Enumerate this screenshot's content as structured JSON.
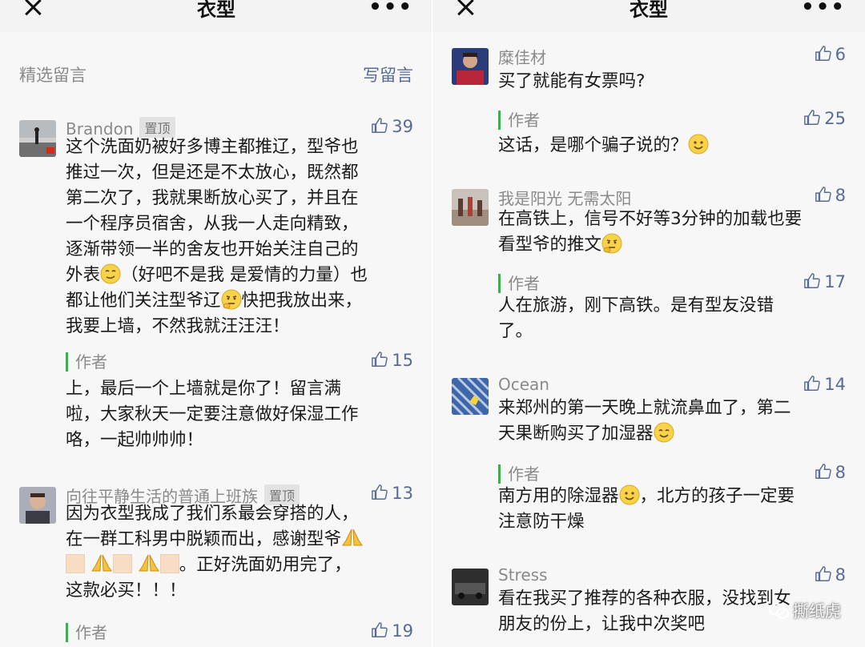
{
  "left": {
    "title": "衣型",
    "featured_label": "精选留言",
    "write_label": "写留言",
    "comments": [
      {
        "name": "Brandon",
        "pin": "置顶",
        "likes": "39",
        "lines": [
          "这个洗面奶被好多博主都推辽，型爷也",
          "推过一次，但是还是不太放心，既然都",
          "第二次了，我就果断放心买了，并且在",
          "一个程序员宿舍，从我一人走向精致，",
          "逐渐带领一半的舍友也开始关注自己的"
        ],
        "line6a": "外表",
        "line6b": "（好吧不是我 是爱情的力量）也",
        "line7a": "都让他们关注型爷辽",
        "line7b": "快把我放出来，",
        "line8": "我要上墙，不然我就汪汪汪！",
        "reply_label": "作者",
        "reply_likes": "15",
        "reply_lines": [
          "上，最后一个上墙就是你了！留言满",
          "啦，大家秋天一定要注意做好保湿工作",
          "咯，一起帅帅帅！"
        ]
      },
      {
        "name": "向往平静生活的普通上班族",
        "pin": "置顶",
        "likes": "13",
        "lines": [
          "因为衣型我成了我们系最会穿搭的人，",
          "在一群工科男中脱颖而出，感谢型爷"
        ],
        "line3b": "。正好洗面奶用完了，",
        "line4": "这款必买！！！",
        "reply_label": "作者",
        "reply_likes": "19"
      }
    ]
  },
  "right": {
    "title": "衣型",
    "comments": [
      {
        "name": "糜佳材",
        "likes": "6",
        "text": "买了就能有女票吗?",
        "reply_label": "作者",
        "reply_likes": "25",
        "reply_text": "这话，是哪个骗子说的？"
      },
      {
        "name": "我是阳光 无需太阳",
        "likes": "8",
        "line1": "在高铁上，信号不好等3分钟的加载也要",
        "line2": "看型爷的推文",
        "reply_label": "作者",
        "reply_likes": "17",
        "reply_line1": "人在旅游，刚下高铁。是有型友没错",
        "reply_line2": "了。"
      },
      {
        "name": "Ocean",
        "likes": "14",
        "line1": "来郑州的第一天晚上就流鼻血了，第二",
        "line2": "天果断购买了加湿器",
        "reply_label": "作者",
        "reply_likes": "8",
        "reply_line1a": "南方用的除湿器",
        "reply_line1b": "，北方的孩子一定要",
        "reply_line2": "注意防干燥"
      },
      {
        "name": "Stress",
        "likes": "8",
        "line1": "看在我买了推荐的各种衣服，没找到女",
        "line2": "朋友的份上，让我中次奖吧"
      }
    ],
    "watermark": "撕纸虎"
  },
  "colors": {
    "link": "#576b95",
    "meta": "#8a8a8a",
    "author_bar": "#2fb54a",
    "text": "#1a1a1a"
  }
}
